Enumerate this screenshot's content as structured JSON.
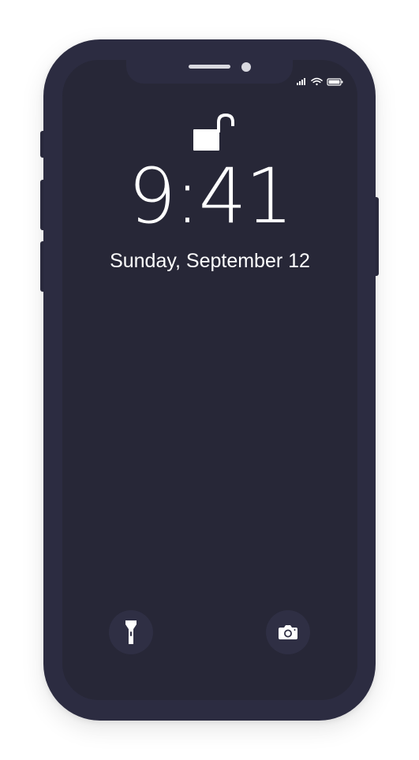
{
  "lock_screen": {
    "time": "9:41",
    "date": "Sunday, September 12",
    "lock_state": "unlocked"
  },
  "status_bar": {
    "icons": [
      "cellular-signal-icon",
      "wifi-icon",
      "battery-icon"
    ]
  },
  "quick_actions": {
    "left": "flashlight-icon",
    "right": "camera-icon"
  },
  "colors": {
    "frame": "#2c2c41",
    "screen": "#272737",
    "button_bg": "#2f2f44",
    "foreground": "#ffffff"
  }
}
